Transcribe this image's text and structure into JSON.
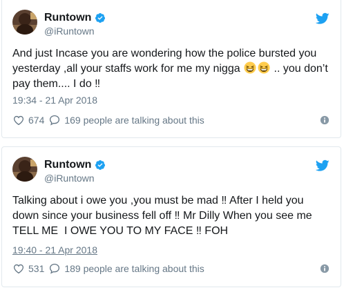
{
  "tweets": [
    {
      "name": "Runtown",
      "handle": "@iRuntown",
      "text_before": "And just Incase you are wondering how the police bursted you yesterday ,all your staffs work for me my nigga ",
      "text_after": " .. you don’t pay them.... I do ‼",
      "timestamp": "19:34 - 21 Apr 2018",
      "likes": "674",
      "talking": "169 people are talking about this"
    },
    {
      "name": "Runtown",
      "handle": "@iRuntown",
      "text": "Talking about i owe you ,you must be mad ‼ After I held you down since your business fell off ‼ Mr Dilly When you see me TELL ME  I OWE YOU TO MY FACE ‼ FOH",
      "timestamp": "19:40 - 21 Apr 2018",
      "likes": "531",
      "talking": "189 people are talking about this"
    }
  ],
  "colors": {
    "twitter_blue": "#1da1f2",
    "secondary_text": "#657786",
    "border": "#e1e8ed"
  },
  "icons": {
    "emoji": "grinning-squinting-face",
    "verified": "verified-badge-icon",
    "logo": "twitter-bird-icon",
    "like": "heart-outline-icon",
    "reply": "speech-bubble-icon",
    "info": "info-circle-icon"
  }
}
